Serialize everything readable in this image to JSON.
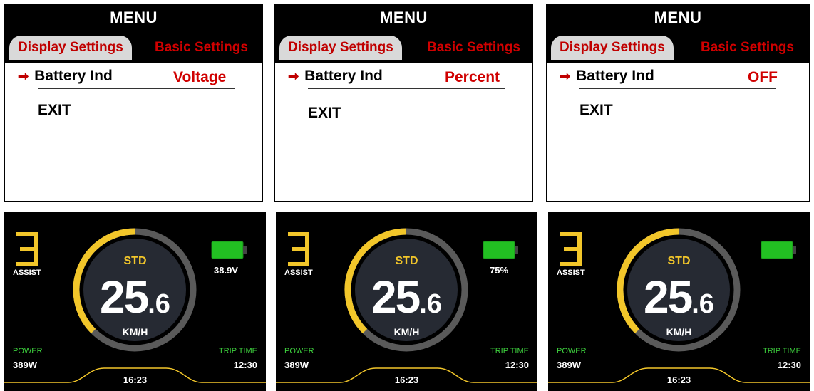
{
  "menu": {
    "title": "MENU",
    "tab_display": "Display Settings",
    "tab_basic": "Basic Settings",
    "row_label": "Battery Ind",
    "exit_label": "EXIT",
    "arrow_icon": "right-arrow-icon",
    "values": [
      "Voltage",
      "Percent",
      "OFF"
    ]
  },
  "dash": {
    "assist_level": "3",
    "assist_label": "ASSIST",
    "mode": "STD",
    "speed_int": "25",
    "speed_dec": ".6",
    "unit": "KM/H",
    "power_label": "POWER",
    "power_value": "389W",
    "trip_label": "TRIP TIME",
    "trip_value": "12:30",
    "clock": "16:23",
    "battery_values": [
      "38.9V",
      "75%",
      ""
    ],
    "battery_icon": "battery-icon"
  },
  "colors": {
    "accent_red": "#d00000",
    "gauge_yellow": "#f2c62a",
    "gauge_gray": "#5a5a5a",
    "battery_green": "#22c022",
    "label_green": "#3ed23e"
  }
}
